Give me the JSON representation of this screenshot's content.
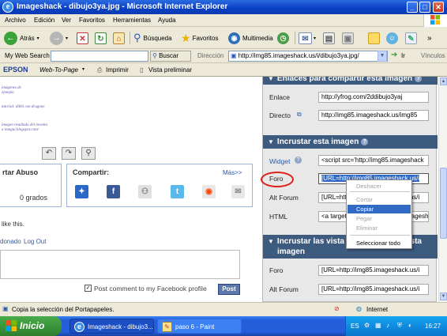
{
  "window": {
    "title": "Imageshack - dibujo3ya.jpg - Microsoft Internet Explorer"
  },
  "menu": {
    "items": [
      "Archivo",
      "Edición",
      "Ver",
      "Favoritos",
      "Herramientas",
      "Ayuda"
    ]
  },
  "toolbar": {
    "back": "Atrás",
    "search": "Búsqueda",
    "favorites": "Favoritos",
    "multimedia": "Multimedia"
  },
  "addressbar": {
    "websearch_label": "My Web Search",
    "buscar": "Buscar",
    "direccion_label": "Dirección",
    "url": "http://img85.imageshack.us/i/dibujo3ya.jpg/",
    "ir": "Ir",
    "vinculos": "Vínculos"
  },
  "epson": {
    "brand": "EPSON",
    "webtopage": "Web-To-Page",
    "imprimir": "Imprimir",
    "vista": "Vista preliminar"
  },
  "image_notes": {
    "line1": "imágenes de",
    "line2": "ejemplo",
    "line3": "tutorial: dibbi con dragone",
    "line4": "imagen resultado del inventa",
    "line5": "a imagui.blogspot.com/"
  },
  "report": {
    "title": "rtar Abuso",
    "count": "0 grados"
  },
  "share": {
    "title": "Compartir:",
    "more": "Más>>"
  },
  "comment": {
    "like_text": "like this.",
    "user": "donado",
    "logout": "Log Out",
    "checkbox_label": "Post comment to my Facebook profile",
    "post_button": "Post"
  },
  "panel": {
    "section1_title": "Enlaces para compartir esta imagen",
    "enlace_label": "Enlace",
    "enlace_value": "http://yfrog.com/2ddibujo3yaj",
    "directo_label": "Directo",
    "directo_value": "http://img85.imageshack.us/img85",
    "section2_title": "Incrustar esta imagen",
    "widget_label": "Widget",
    "widget_value": "<script src='http://img85.imageshack",
    "foro_label": "Foro",
    "foro_value": "[URL=http://img85.imageshack.us/i",
    "altforum_label": "Alt Forum",
    "altforum_value": "[URL=http://img85.imageshack.us/i",
    "html_label": "HTML",
    "html_value": "<a target='_blank' href='http://imageshack",
    "section3_title_line1": "Incrustar las vista",
    "section3_title_tail": "esta",
    "section3_title_line2": "imagen",
    "foro2_label": "Foro",
    "foro2_value": "[URL=http://img85.imageshack.us/i",
    "altforum2_label": "Alt Forum",
    "altforum2_value": "[URL=http://img85.imageshack.us/i"
  },
  "context_menu": {
    "items": [
      "Deshacer",
      "Cortar",
      "Copiar",
      "Pegar",
      "Eliminar",
      "Seleccionar todo"
    ],
    "highlighted": "Copiar"
  },
  "status": {
    "text": "Copia la selección del Portapapeles.",
    "zone": "Internet"
  },
  "taskbar": {
    "start": "Inicio",
    "items": [
      "Imageshack - dibujo3...",
      "paso 6 - Paint"
    ],
    "lang": "ES",
    "clock": "16:27"
  },
  "colors": {
    "panel_header": "#3d5a7f",
    "selection": "#316ac5",
    "annotation_circle": "#e0201a"
  }
}
